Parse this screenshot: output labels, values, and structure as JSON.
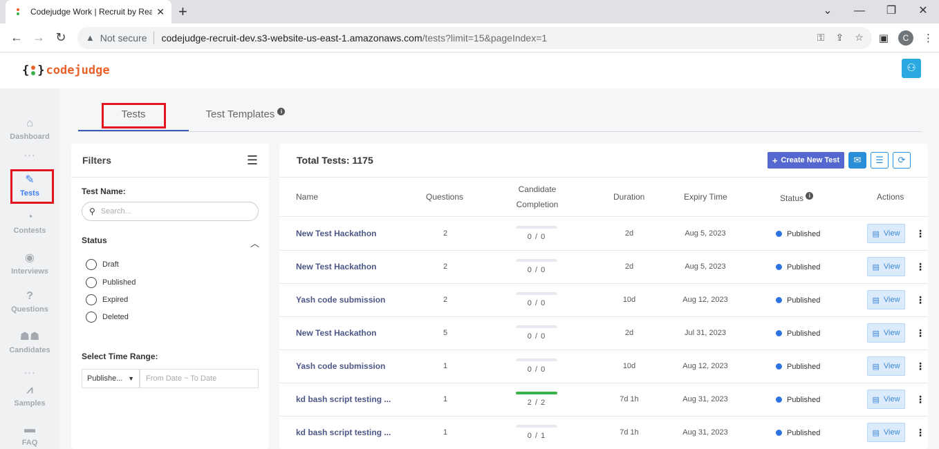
{
  "browser": {
    "tab_title": "Codejudge Work | Recruit by Rea",
    "address_security": "Not secure",
    "url_host": "codejudge-recruit-dev.s3-website-us-east-1.amazonaws.com",
    "url_path": "/tests?limit=15&pageIndex=1",
    "profile_initial": "C"
  },
  "logo": {
    "left_brace": "{",
    "right_brace": "}",
    "name": "codejudge"
  },
  "sidebar": {
    "items": [
      {
        "label": "Dashboard",
        "icon": "home-icon"
      },
      {
        "label": "Tests",
        "icon": "pencil-icon"
      },
      {
        "label": "Contests",
        "icon": "pie-chart-icon"
      },
      {
        "label": "Interviews",
        "icon": "podcast-icon"
      },
      {
        "label": "Questions",
        "icon": "question-icon"
      },
      {
        "label": "Candidates",
        "icon": "users-icon"
      },
      {
        "label": "Samples",
        "icon": "line-chart-icon"
      },
      {
        "label": "FAQ",
        "icon": "comments-icon"
      }
    ],
    "dots": "···"
  },
  "tabs": [
    {
      "label": "Tests"
    },
    {
      "label": "Test Templates"
    }
  ],
  "filters": {
    "title": "Filters",
    "test_name_label": "Test Name:",
    "search_placeholder": "Search...",
    "status_label": "Status",
    "status_options": [
      "Draft",
      "Published",
      "Expired",
      "Deleted"
    ],
    "time_range_label": "Select Time Range:",
    "time_select_value": "Publishe...",
    "date_placeholder": "From Date ~ To Date"
  },
  "table": {
    "total": "Total Tests: 1175",
    "create_label": "Create New Test",
    "headers": {
      "name": "Name",
      "questions": "Questions",
      "completion_1": "Candidate",
      "completion_2": "Completion",
      "duration": "Duration",
      "expiry": "Expiry Time",
      "status": "Status",
      "actions": "Actions"
    },
    "view_label": "View",
    "rows": [
      {
        "name": "New Test Hackathon",
        "questions": "2",
        "completion": "0 / 0",
        "progress": 0,
        "duration": "2d",
        "expiry": "Aug 5, 2023",
        "status": "Published"
      },
      {
        "name": "New Test Hackathon",
        "questions": "2",
        "completion": "0 / 0",
        "progress": 0,
        "duration": "2d",
        "expiry": "Aug 5, 2023",
        "status": "Published"
      },
      {
        "name": "Yash code submission",
        "questions": "2",
        "completion": "0 / 0",
        "progress": 0,
        "duration": "10d",
        "expiry": "Aug 12, 2023",
        "status": "Published"
      },
      {
        "name": "New Test Hackathon",
        "questions": "5",
        "completion": "0 / 0",
        "progress": 0,
        "duration": "2d",
        "expiry": "Jul 31, 2023",
        "status": "Published"
      },
      {
        "name": "Yash code submission",
        "questions": "1",
        "completion": "0 / 0",
        "progress": 0,
        "duration": "10d",
        "expiry": "Aug 12, 2023",
        "status": "Published"
      },
      {
        "name": "kd bash script testing ...",
        "questions": "1",
        "completion": "2 / 2",
        "progress": 1,
        "duration": "7d 1h",
        "expiry": "Aug 31, 2023",
        "status": "Published"
      },
      {
        "name": "kd bash script testing ...",
        "questions": "1",
        "completion": "0 / 1",
        "progress": 0,
        "duration": "7d 1h",
        "expiry": "Aug 31, 2023",
        "status": "Published"
      }
    ]
  },
  "colors": {
    "accent": "#5568cf",
    "highlight": "#e3141e",
    "status_published": "#2f73e0",
    "progress": "#3ab04a"
  }
}
